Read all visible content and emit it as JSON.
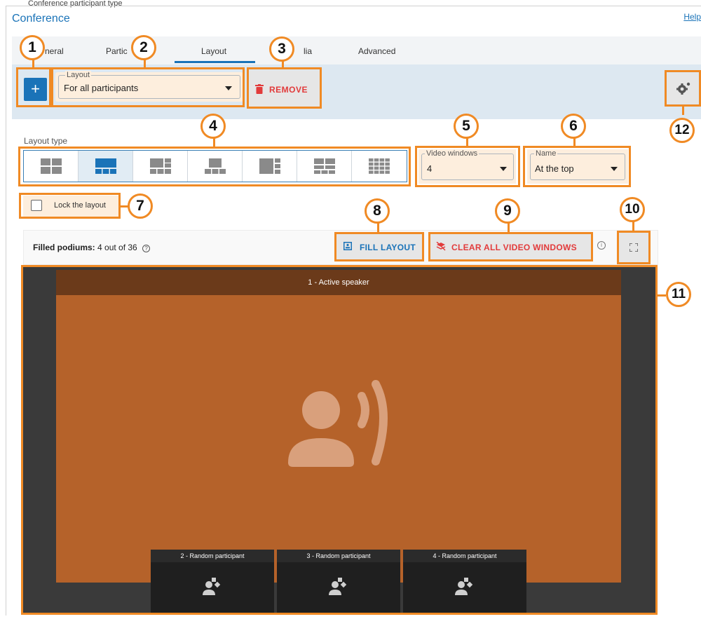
{
  "page": {
    "breadcrumb": "Conference participant type",
    "title": "Conference",
    "help_link": "Help"
  },
  "tabs": [
    {
      "label": "General",
      "visible": "neral"
    },
    {
      "label": "Participants",
      "visible": "Partic"
    },
    {
      "label": "Layout",
      "visible": "Layout",
      "active": true
    },
    {
      "label": "Media",
      "visible": "lia"
    },
    {
      "label": "Advanced",
      "visible": "Advanced"
    }
  ],
  "toolbar": {
    "add_label": "+",
    "layout_select": {
      "legend": "Layout",
      "value": "For all participants"
    },
    "remove_label": "REMOVE"
  },
  "layout_type": {
    "label": "Layout type",
    "options": [
      "layout-2x2",
      "layout-1-plus-3-bottom",
      "layout-1-plus-4-right",
      "layout-1-plus-3-narrow",
      "layout-1-plus-5-side",
      "layout-2x2-plus-3",
      "layout-4x4"
    ],
    "selected_index": 1
  },
  "video_windows": {
    "legend": "Video windows",
    "value": "4"
  },
  "name_select": {
    "legend": "Name",
    "value": "At the top"
  },
  "lock": {
    "label": "Lock the layout",
    "checked": false
  },
  "podiums": {
    "label": "Filled podiums:",
    "value": "4 out of 36",
    "fill_label": "FILL LAYOUT",
    "clear_label": "CLEAR ALL VIDEO WINDOWS"
  },
  "stage": {
    "speaker_label": "1 - Active speaker",
    "thumbs": [
      "2 - Random participant",
      "3 - Random participant",
      "4 - Random participant"
    ]
  },
  "annotations": [
    "1",
    "2",
    "3",
    "4",
    "5",
    "6",
    "7",
    "8",
    "9",
    "10",
    "11",
    "12"
  ],
  "colors": {
    "accent": "#1a73b8",
    "danger": "#e23b3b",
    "highlight": "#f08a24",
    "speaker": "#b5622a"
  }
}
